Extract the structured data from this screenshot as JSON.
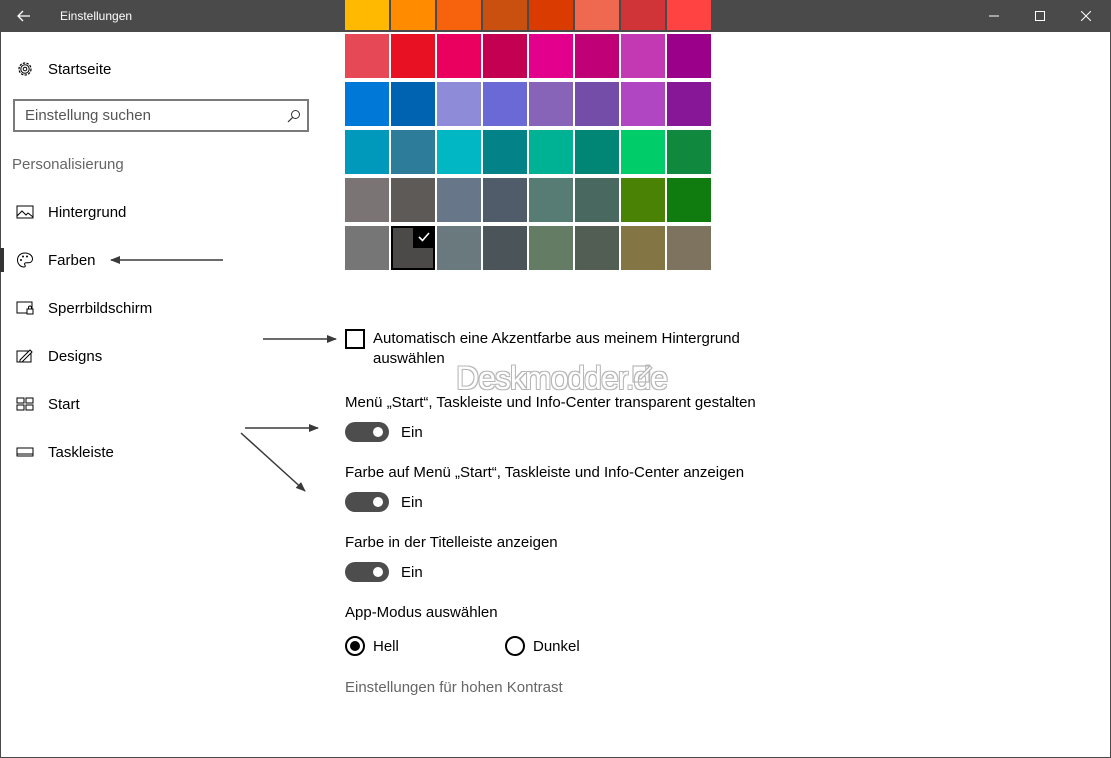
{
  "window": {
    "title": "Einstellungen"
  },
  "sidebar": {
    "home_label": "Startseite",
    "search_placeholder": "Einstellung suchen",
    "section_title": "Personalisierung",
    "items": [
      {
        "label": "Hintergrund",
        "icon": "picture-icon"
      },
      {
        "label": "Farben",
        "icon": "palette-icon",
        "active": true
      },
      {
        "label": "Sperrbildschirm",
        "icon": "lock-screen-icon"
      },
      {
        "label": "Designs",
        "icon": "themes-icon"
      },
      {
        "label": "Start",
        "icon": "start-icon"
      },
      {
        "label": "Taskleiste",
        "icon": "taskbar-icon"
      }
    ]
  },
  "colors": {
    "selected_row": 5,
    "selected_col": 1,
    "rows": [
      [
        "#FFB900",
        "#FF8C00",
        "#F7630C",
        "#CA5010",
        "#DA3B01",
        "#EF6950",
        "#D13438",
        "#FF4343"
      ],
      [
        "#E74856",
        "#E81123",
        "#EA005E",
        "#C30052",
        "#E3008C",
        "#BF0077",
        "#C239B3",
        "#9A0089"
      ],
      [
        "#0078D7",
        "#0063B1",
        "#8E8CD8",
        "#6B69D6",
        "#8764B8",
        "#744DA9",
        "#B146C2",
        "#881798"
      ],
      [
        "#0099BC",
        "#2D7D9A",
        "#00B7C3",
        "#038387",
        "#00B294",
        "#018574",
        "#00CC6A",
        "#10893E"
      ],
      [
        "#7A7574",
        "#5D5A58",
        "#68768A",
        "#515C6B",
        "#567C73",
        "#486860",
        "#498205",
        "#107C10"
      ],
      [
        "#767676",
        "#4C4A48",
        "#69797E",
        "#4A5459",
        "#647C64",
        "#525E54",
        "#847545",
        "#7E735F"
      ]
    ]
  },
  "auto_accent": {
    "label": "Automatisch eine Akzentfarbe aus meinem Hintergrund auswählen",
    "checked": false
  },
  "watermark": "Deskmodder.de",
  "toggles": [
    {
      "label": "Menü „Start“, Taskleiste und Info-Center transparent gestalten",
      "state": "Ein",
      "on": true
    },
    {
      "label": "Farbe auf Menü „Start“, Taskleiste und Info-Center anzeigen",
      "state": "Ein",
      "on": true
    },
    {
      "label": "Farbe in der Titelleiste anzeigen",
      "state": "Ein",
      "on": true
    }
  ],
  "app_mode": {
    "label": "App-Modus auswählen",
    "options": [
      {
        "label": "Hell",
        "selected": true
      },
      {
        "label": "Dunkel",
        "selected": false
      }
    ]
  },
  "contrast_link": "Einstellungen für hohen Kontrast"
}
